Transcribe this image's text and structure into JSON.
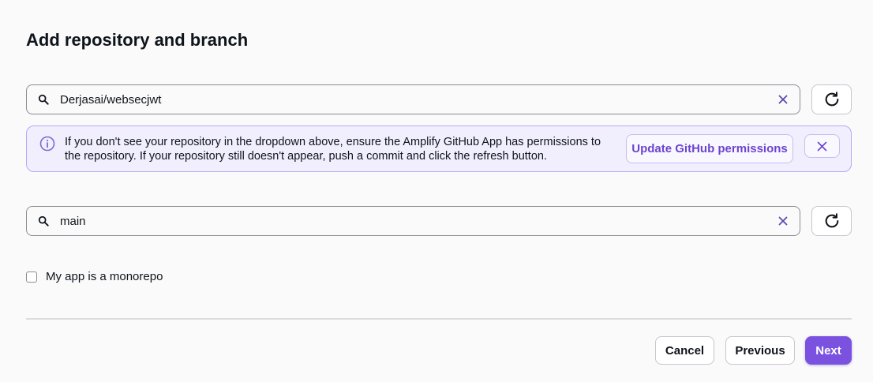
{
  "page": {
    "title": "Add repository and branch"
  },
  "repository": {
    "value": "Derjasai/websecjwt",
    "placeholder": ""
  },
  "alert": {
    "text": "If you don't see your repository in the dropdown above, ensure the Amplify GitHub App has permissions to the repository. If your repository still doesn't appear, push a commit and click the refresh button.",
    "button_label": "Update GitHub permissions"
  },
  "branch": {
    "value": "main",
    "placeholder": ""
  },
  "monorepo": {
    "label": "My app is a monorepo",
    "checked": false
  },
  "footer": {
    "cancel_label": "Cancel",
    "previous_label": "Previous",
    "next_label": "Next"
  },
  "colors": {
    "accent": "#7b52e0",
    "alert_background": "#f1effe",
    "alert_border": "#b8a8f1"
  },
  "icons": [
    "search-icon",
    "clear-icon",
    "refresh-icon",
    "info-icon",
    "close-icon"
  ]
}
